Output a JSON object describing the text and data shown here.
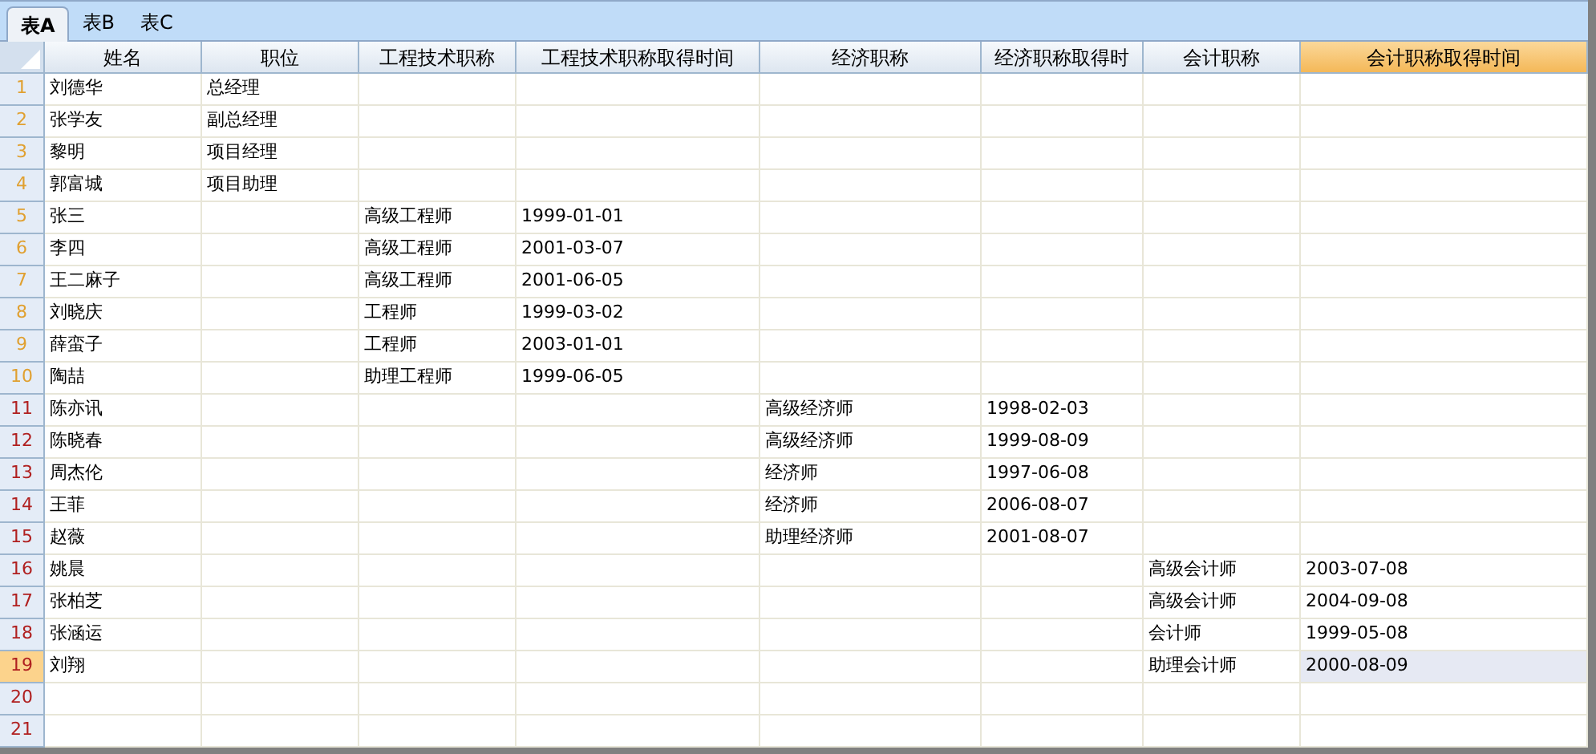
{
  "tabs": [
    {
      "label": "表A",
      "selected": true
    },
    {
      "label": "表B",
      "selected": false
    },
    {
      "label": "表C",
      "selected": false
    }
  ],
  "columns": [
    {
      "label": "姓名",
      "selected": false
    },
    {
      "label": "职位",
      "selected": false
    },
    {
      "label": "工程技术职称",
      "selected": false
    },
    {
      "label": "工程技术职称取得时间",
      "selected": false
    },
    {
      "label": "经济职称",
      "selected": false
    },
    {
      "label": "经济职称取得时",
      "selected": false
    },
    {
      "label": "会计职称",
      "selected": false
    },
    {
      "label": "会计职称取得时间",
      "selected": true
    }
  ],
  "rows": [
    {
      "number": "1",
      "color": "#e0a030",
      "selected": false,
      "cells": [
        "刘德华",
        "总经理",
        null,
        null,
        null,
        null,
        null,
        null
      ]
    },
    {
      "number": "2",
      "color": "#e0a030",
      "selected": false,
      "cells": [
        "张学友",
        "副总经理",
        null,
        null,
        null,
        null,
        null,
        null
      ]
    },
    {
      "number": "3",
      "color": "#e0a030",
      "selected": false,
      "cells": [
        "黎明",
        "项目经理",
        null,
        null,
        null,
        null,
        null,
        null
      ]
    },
    {
      "number": "4",
      "color": "#e0a030",
      "selected": false,
      "cells": [
        "郭富城",
        "项目助理",
        null,
        null,
        null,
        null,
        null,
        null
      ]
    },
    {
      "number": "5",
      "color": "#e0a030",
      "selected": false,
      "cells": [
        "张三",
        null,
        "高级工程师",
        "1999-01-01",
        null,
        null,
        null,
        null
      ]
    },
    {
      "number": "6",
      "color": "#e0a030",
      "selected": false,
      "cells": [
        "李四",
        null,
        "高级工程师",
        "2001-03-07",
        null,
        null,
        null,
        null
      ]
    },
    {
      "number": "7",
      "color": "#e0a030",
      "selected": false,
      "cells": [
        "王二麻子",
        null,
        "高级工程师",
        "2001-06-05",
        null,
        null,
        null,
        null
      ]
    },
    {
      "number": "8",
      "color": "#e0a030",
      "selected": false,
      "cells": [
        "刘晓庆",
        null,
        "工程师",
        "1999-03-02",
        null,
        null,
        null,
        null
      ]
    },
    {
      "number": "9",
      "color": "#e0a030",
      "selected": false,
      "cells": [
        "薛蛮子",
        null,
        "工程师",
        "2003-01-01",
        null,
        null,
        null,
        null
      ]
    },
    {
      "number": "10",
      "color": "#e0a030",
      "selected": false,
      "cells": [
        "陶喆",
        null,
        "助理工程师",
        "1999-06-05",
        null,
        null,
        null,
        null
      ]
    },
    {
      "number": "11",
      "color": "#b02020",
      "selected": false,
      "cells": [
        "陈亦讯",
        null,
        null,
        null,
        "高级经济师",
        "1998-02-03",
        null,
        null
      ]
    },
    {
      "number": "12",
      "color": "#b02020",
      "selected": false,
      "cells": [
        "陈晓春",
        null,
        null,
        null,
        "高级经济师",
        "1999-08-09",
        null,
        null
      ]
    },
    {
      "number": "13",
      "color": "#b02020",
      "selected": false,
      "cells": [
        "周杰伦",
        null,
        null,
        null,
        "经济师",
        "1997-06-08",
        null,
        null
      ]
    },
    {
      "number": "14",
      "color": "#b02020",
      "selected": false,
      "cells": [
        "王菲",
        null,
        null,
        null,
        "经济师",
        "2006-08-07",
        null,
        null
      ]
    },
    {
      "number": "15",
      "color": "#b02020",
      "selected": false,
      "cells": [
        "赵薇",
        null,
        null,
        null,
        "助理经济师",
        "2001-08-07",
        null,
        null
      ]
    },
    {
      "number": "16",
      "color": "#b02020",
      "selected": false,
      "cells": [
        "姚晨",
        null,
        null,
        null,
        null,
        null,
        "高级会计师",
        "2003-07-08"
      ]
    },
    {
      "number": "17",
      "color": "#b02020",
      "selected": false,
      "cells": [
        "张柏芝",
        null,
        null,
        null,
        null,
        null,
        "高级会计师",
        "2004-09-08"
      ]
    },
    {
      "number": "18",
      "color": "#b02020",
      "selected": false,
      "cells": [
        "张涵运",
        null,
        null,
        null,
        null,
        null,
        "会计师",
        "1999-05-08"
      ]
    },
    {
      "number": "19",
      "color": "#b02020",
      "selected": true,
      "cells": [
        "刘翔",
        null,
        null,
        null,
        null,
        null,
        "助理会计师",
        "2000-08-09"
      ]
    },
    {
      "number": "20",
      "color": "#b02020",
      "selected": false
    },
    {
      "number": "21",
      "color": "#b02020",
      "selected": false
    }
  ]
}
